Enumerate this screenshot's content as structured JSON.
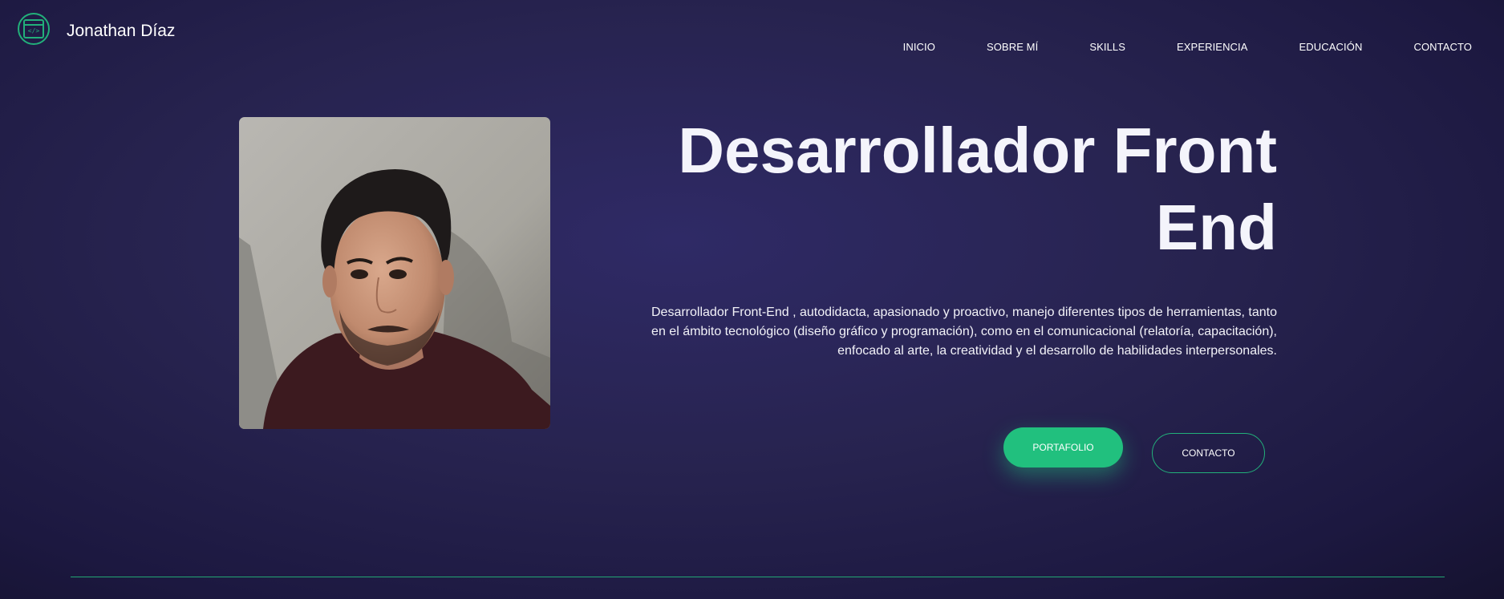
{
  "header": {
    "logo_icon": "code-window-icon",
    "logo_code": "</>",
    "brand_name": "Jonathan Díaz",
    "nav": [
      {
        "label": "INICIO"
      },
      {
        "label": "SOBRE MÍ"
      },
      {
        "label": "SKILLS"
      },
      {
        "label": "EXPERIENCIA"
      },
      {
        "label": "EDUCACIÓN"
      },
      {
        "label": "CONTACTO"
      }
    ]
  },
  "hero": {
    "title": "Desarrollador Front End",
    "description": "Desarrollador Front-End , autodidacta, apasionado y proactivo, manejo diferentes tipos de herramientas, tanto en el ámbito tecnológico (diseño gráfico y programación), como en el comunicacional (relatoría, capacitación), enfocado al arte, la creatividad y el desarrollo de habilidades interpersonales.",
    "primary_button": "PORTAFOLIO",
    "secondary_button": "CONTACTO"
  },
  "colors": {
    "accent": "#22b07a",
    "button": "#21c07e",
    "background": "#27234f"
  }
}
